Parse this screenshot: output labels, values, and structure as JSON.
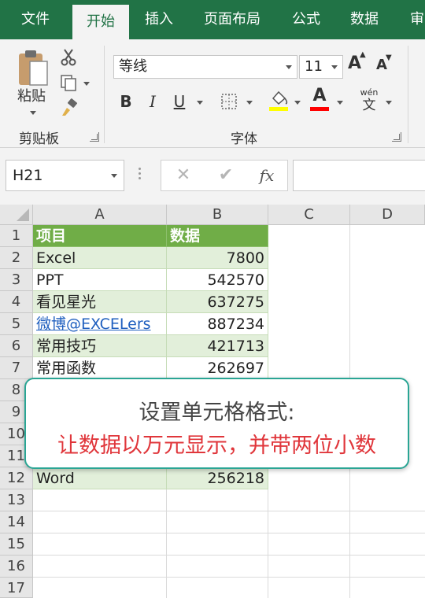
{
  "ribbon": {
    "tabs": [
      "文件",
      "开始",
      "插入",
      "页面布局",
      "公式",
      "数据",
      "审阅"
    ],
    "active_tab": "开始",
    "clipboard": {
      "paste_label": "粘贴",
      "group_label": "剪贴板"
    },
    "font": {
      "family": "等线",
      "size": "11",
      "group_label": "字体",
      "bold": "B",
      "italic": "I",
      "underline": "U",
      "font_color_glyph": "A",
      "phonetic_top": "wén",
      "phonetic_bottom": "文",
      "grow_glyph": "A",
      "shrink_glyph": "A"
    },
    "colors": {
      "fill_highlight": "#ffff00",
      "font_color": "#ff0000",
      "accent": "#217346"
    }
  },
  "formula_bar": {
    "name_box": "H21",
    "cancel": "✕",
    "enter": "✔",
    "fx": "fx",
    "content": ""
  },
  "sheet": {
    "columns": [
      "A",
      "B",
      "C",
      "D"
    ],
    "rows": [
      "1",
      "2",
      "3",
      "4",
      "5",
      "6",
      "7",
      "8",
      "9",
      "10",
      "11",
      "12",
      "13",
      "14",
      "15",
      "16",
      "17"
    ],
    "header": [
      "项目",
      "数据"
    ],
    "data": [
      [
        "Excel",
        "7800"
      ],
      [
        "PPT",
        "542570"
      ],
      [
        "看见星光",
        "637275"
      ],
      [
        "微博@EXCELers",
        "887234"
      ],
      [
        "常用技巧",
        "421713"
      ],
      [
        "常用函数",
        "262697"
      ],
      [
        "",
        ""
      ],
      [
        "",
        ""
      ],
      [
        "",
        ""
      ],
      [
        "",
        ""
      ],
      [
        "Word",
        "256218"
      ]
    ],
    "header_color": "#70ad47",
    "band_color": "#e2efda"
  },
  "callout": {
    "line1": "设置单元格格式:",
    "line2": "让数据以万元显示，并带两位小数",
    "border_color": "#2aa594",
    "highlight_color": "#e0363b"
  }
}
